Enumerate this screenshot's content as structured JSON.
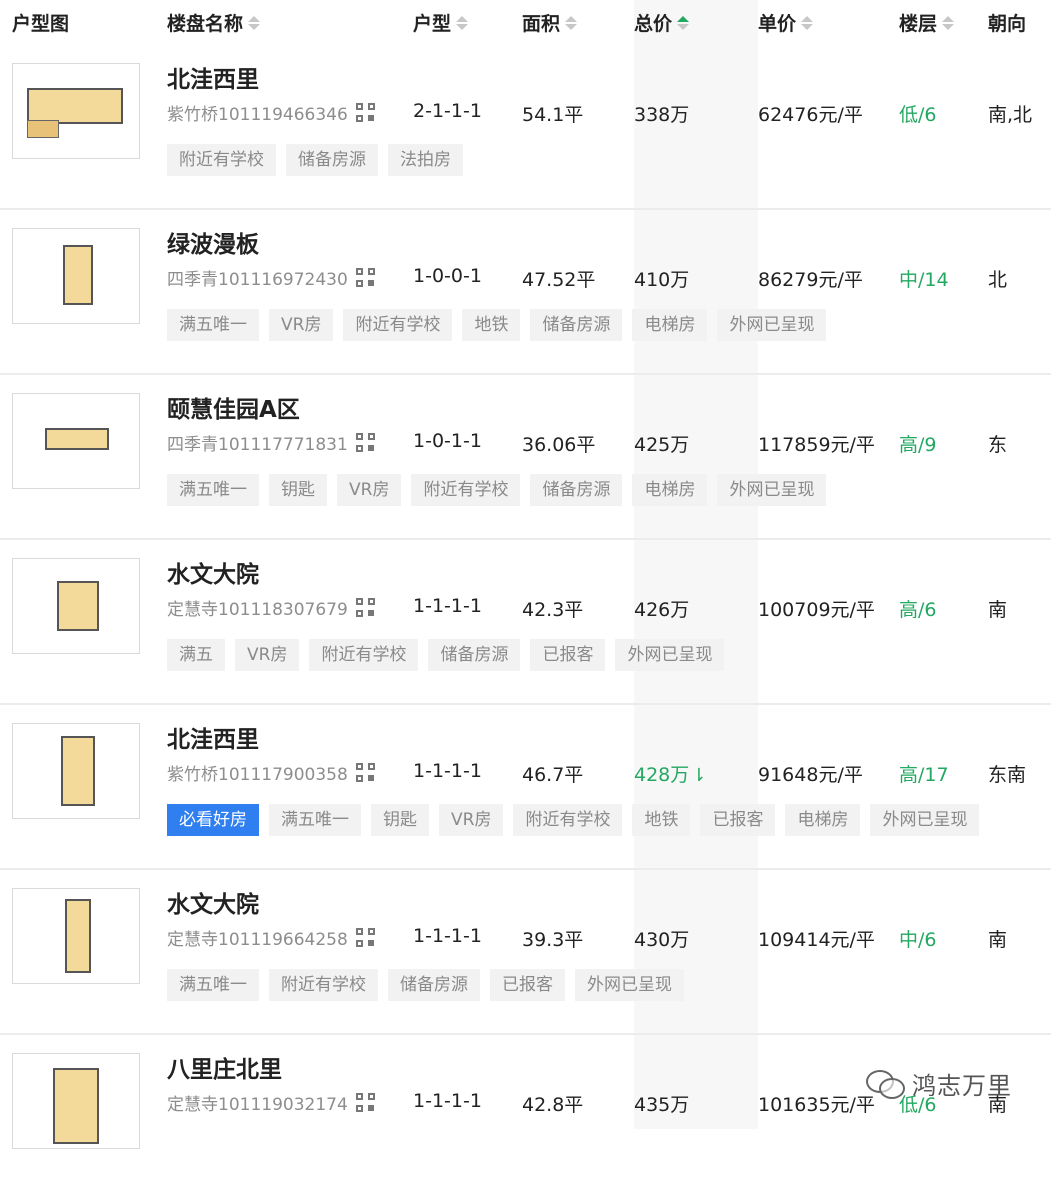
{
  "header": {
    "columns": [
      "户型图",
      "楼盘名称",
      "户型",
      "面积",
      "总价",
      "单价",
      "楼层",
      "朝向"
    ]
  },
  "rows": [
    {
      "name": "北洼西里",
      "code": "紫竹桥101119466346",
      "layout": "2-1-1-1",
      "area": "54.1平",
      "total": "338万",
      "unit": "62476元/平",
      "floor": "低/6",
      "orient": "南,北",
      "tags": [
        "附近有学校",
        "储备房源",
        "法拍房"
      ]
    },
    {
      "name": "绿波漫板",
      "code": "四季青101116972430",
      "layout": "1-0-0-1",
      "area": "47.52平",
      "total": "410万",
      "unit": "86279元/平",
      "floor": "中/14",
      "orient": "北",
      "tags": [
        "满五唯一",
        "VR房",
        "附近有学校",
        "地铁",
        "储备房源",
        "电梯房",
        "外网已呈现"
      ]
    },
    {
      "name": "颐慧佳园A区",
      "code": "四季青101117771831",
      "layout": "1-0-1-1",
      "area": "36.06平",
      "total": "425万",
      "unit": "117859元/平",
      "floor": "高/9",
      "orient": "东",
      "tags": [
        "满五唯一",
        "钥匙",
        "VR房",
        "附近有学校",
        "储备房源",
        "电梯房",
        "外网已呈现"
      ]
    },
    {
      "name": "水文大院",
      "code": "定慧寺101118307679",
      "layout": "1-1-1-1",
      "area": "42.3平",
      "total": "426万",
      "unit": "100709元/平",
      "floor": "高/6",
      "orient": "南",
      "tags": [
        "满五",
        "VR房",
        "附近有学校",
        "储备房源",
        "已报客",
        "外网已呈现"
      ]
    },
    {
      "name": "北洼西里",
      "code": "紫竹桥101117900358",
      "layout": "1-1-1-1",
      "area": "46.7平",
      "total": "428万",
      "unit": "91648元/平",
      "floor": "高/17",
      "orient": "东南",
      "primary_tag": "必看好房",
      "tags": [
        "满五唯一",
        "钥匙",
        "VR房",
        "附近有学校",
        "地铁",
        "已报客",
        "电梯房",
        "外网已呈现"
      ]
    },
    {
      "name": "水文大院",
      "code": "定慧寺101119664258",
      "layout": "1-1-1-1",
      "area": "39.3平",
      "total": "430万",
      "unit": "109414元/平",
      "floor": "中/6",
      "orient": "南",
      "tags": [
        "满五唯一",
        "附近有学校",
        "储备房源",
        "已报客",
        "外网已呈现"
      ]
    },
    {
      "name": "八里庄北里",
      "code": "定慧寺101119032174",
      "layout": "1-1-1-1",
      "area": "42.8平",
      "total": "435万",
      "unit": "101635元/平",
      "floor": "低/6",
      "orient": "南",
      "tags": []
    }
  ],
  "watermark": "鸿志万里",
  "colors": {
    "accent": "#22a861",
    "primary_tag": "#2f7ff0"
  },
  "icons": {
    "sort": "sort-icon",
    "qr": "qr-code-icon",
    "price_down": "price-down-icon",
    "wechat": "wechat-icon"
  }
}
